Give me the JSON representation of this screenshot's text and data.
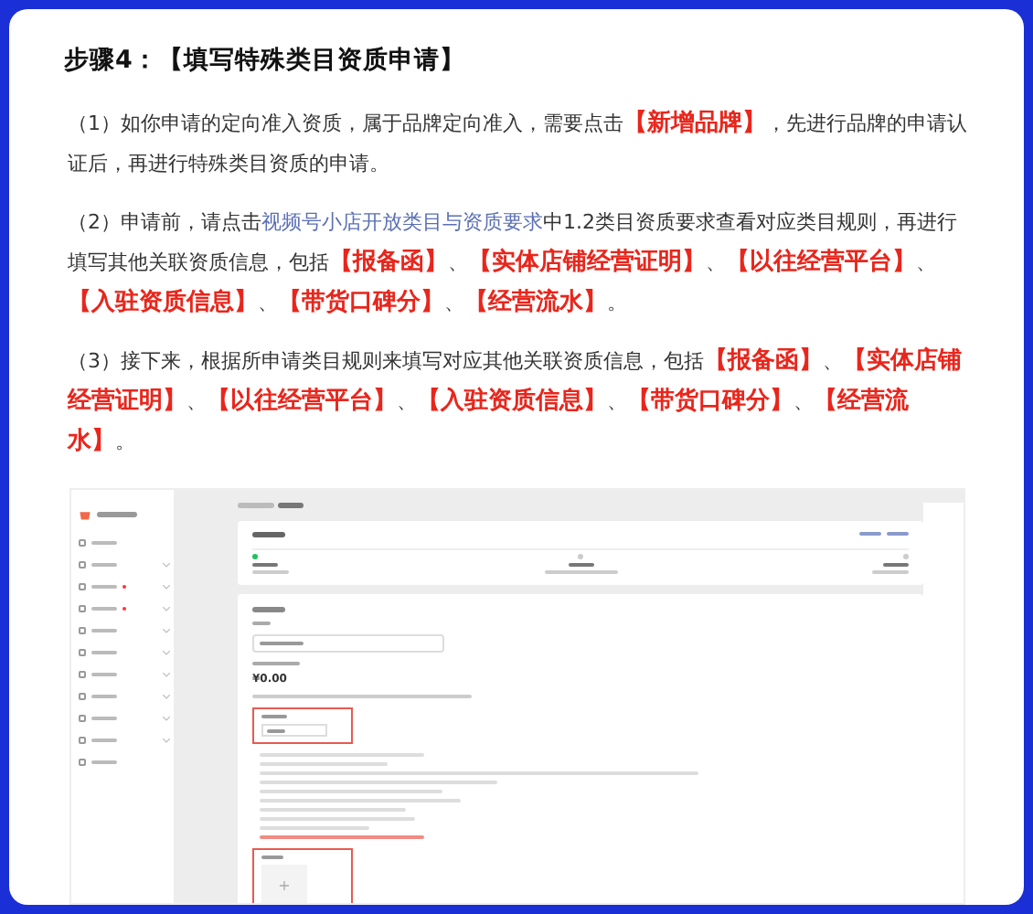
{
  "heading": "步骤4：【填写特殊类目资质申请】",
  "paragraphs": [
    [
      {
        "kind": "text",
        "text": "（1）如你申请的定向准入资质，属于品牌定向准入，需要点击"
      },
      {
        "kind": "highlight",
        "text": "【新增品牌】"
      },
      {
        "kind": "text",
        "text": "，先进行品牌的申请认证后，再进行特殊类目资质的申请。"
      }
    ],
    [
      {
        "kind": "text",
        "text": "（2）申请前，请点击"
      },
      {
        "kind": "link",
        "text": "视频号小店开放类目与资质要求"
      },
      {
        "kind": "text",
        "text": "中1.2类目资质要求查看对应类目规则，再进行填写其他关联资质信息，包括"
      },
      {
        "kind": "highlight",
        "text": "【报备函】"
      },
      {
        "kind": "text",
        "text": "、"
      },
      {
        "kind": "highlight",
        "text": "【实体店铺经营证明】"
      },
      {
        "kind": "text",
        "text": "、"
      },
      {
        "kind": "highlight",
        "text": "【以往经营平台】"
      },
      {
        "kind": "text",
        "text": "、"
      },
      {
        "kind": "highlight",
        "text": "【入驻资质信息】"
      },
      {
        "kind": "text",
        "text": "、"
      },
      {
        "kind": "highlight",
        "text": "【带货口碑分】"
      },
      {
        "kind": "text",
        "text": "、"
      },
      {
        "kind": "highlight",
        "text": "【经营流水】"
      },
      {
        "kind": "text",
        "text": "。"
      }
    ],
    [
      {
        "kind": "text",
        "text": "（3）接下来，根据所申请类目规则来填写对应其他关联资质信息，包括"
      },
      {
        "kind": "highlight",
        "text": "【报备函】"
      },
      {
        "kind": "text",
        "text": "、"
      },
      {
        "kind": "highlight",
        "text": "【实体店铺经营证明】"
      },
      {
        "kind": "text",
        "text": "、"
      },
      {
        "kind": "highlight",
        "text": "【以往经营平台】"
      },
      {
        "kind": "text",
        "text": "、"
      },
      {
        "kind": "highlight",
        "text": "【入驻资质信息】"
      },
      {
        "kind": "text",
        "text": "、"
      },
      {
        "kind": "highlight",
        "text": "【带货口碑分】"
      },
      {
        "kind": "text",
        "text": "、"
      },
      {
        "kind": "highlight",
        "text": "【经营流水】"
      },
      {
        "kind": "text",
        "text": "。"
      }
    ]
  ],
  "screenshot": {
    "sidebar_items": [
      {
        "expandable": false,
        "badge": false
      },
      {
        "expandable": true,
        "badge": false
      },
      {
        "expandable": true,
        "badge": true
      },
      {
        "expandable": true,
        "badge": true
      },
      {
        "expandable": true,
        "badge": false
      },
      {
        "expandable": true,
        "badge": false
      },
      {
        "expandable": true,
        "badge": false
      },
      {
        "expandable": true,
        "badge": false
      },
      {
        "expandable": true,
        "badge": false
      },
      {
        "expandable": true,
        "badge": false
      },
      {
        "expandable": false,
        "badge": false
      }
    ],
    "steps": [
      {
        "done": true
      },
      {
        "done": false
      },
      {
        "done": false
      }
    ],
    "amount": "¥0.00",
    "upload_plus": "+"
  }
}
